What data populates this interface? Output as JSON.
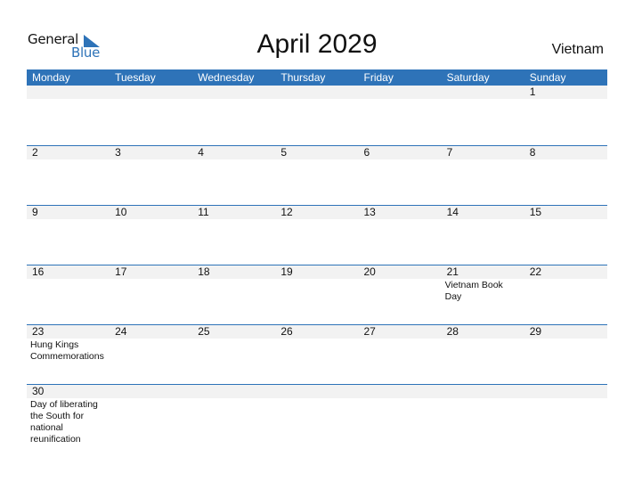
{
  "logo": {
    "line1": "General",
    "line2": "Blue",
    "icon": "triangle-flag-icon",
    "accent": "#2e73b8"
  },
  "header": {
    "title": "April 2029",
    "country": "Vietnam"
  },
  "calendar": {
    "weekdays": [
      "Monday",
      "Tuesday",
      "Wednesday",
      "Thursday",
      "Friday",
      "Saturday",
      "Sunday"
    ],
    "weeks": [
      [
        {
          "d": ""
        },
        {
          "d": ""
        },
        {
          "d": ""
        },
        {
          "d": ""
        },
        {
          "d": ""
        },
        {
          "d": ""
        },
        {
          "d": "1"
        }
      ],
      [
        {
          "d": "2"
        },
        {
          "d": "3"
        },
        {
          "d": "4"
        },
        {
          "d": "5"
        },
        {
          "d": "6"
        },
        {
          "d": "7"
        },
        {
          "d": "8"
        }
      ],
      [
        {
          "d": "9"
        },
        {
          "d": "10"
        },
        {
          "d": "11"
        },
        {
          "d": "12"
        },
        {
          "d": "13"
        },
        {
          "d": "14"
        },
        {
          "d": "15"
        }
      ],
      [
        {
          "d": "16"
        },
        {
          "d": "17"
        },
        {
          "d": "18"
        },
        {
          "d": "19"
        },
        {
          "d": "20"
        },
        {
          "d": "21",
          "h": "Vietnam Book Day"
        },
        {
          "d": "22"
        }
      ],
      [
        {
          "d": "23",
          "h": "Hung Kings Commemorations"
        },
        {
          "d": "24"
        },
        {
          "d": "25"
        },
        {
          "d": "26"
        },
        {
          "d": "27"
        },
        {
          "d": "28"
        },
        {
          "d": "29"
        }
      ],
      [
        {
          "d": "30",
          "h": "Day of liberating the South for national reunification"
        },
        {
          "d": ""
        },
        {
          "d": ""
        },
        {
          "d": ""
        },
        {
          "d": ""
        },
        {
          "d": ""
        },
        {
          "d": ""
        }
      ]
    ]
  },
  "colors": {
    "header_bg": "#2e73b8",
    "date_strip": "#f2f2f2"
  }
}
